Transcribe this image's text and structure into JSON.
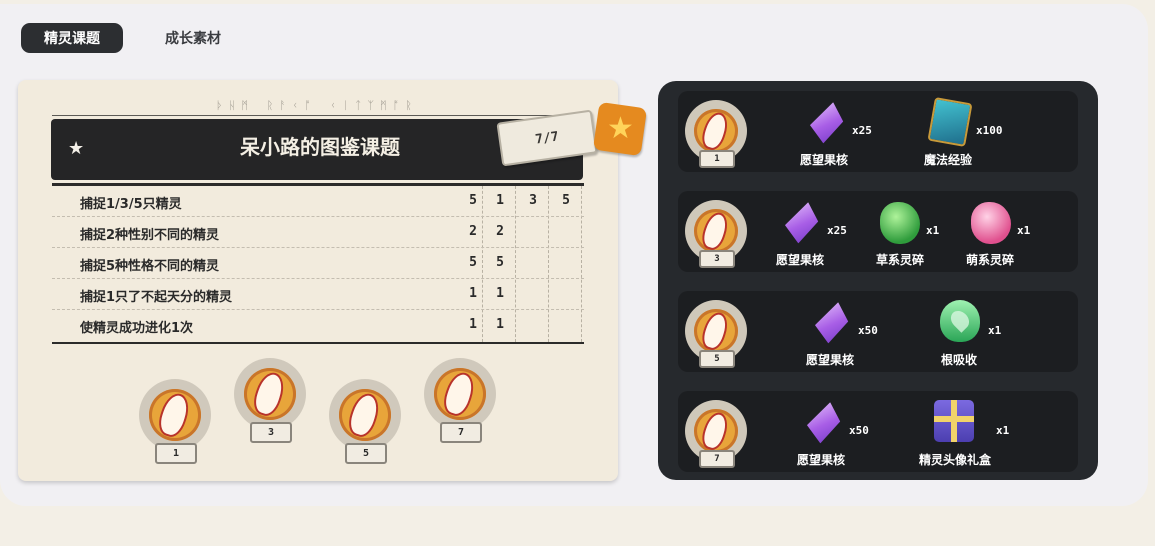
{
  "tabs": [
    {
      "label": "精灵课题",
      "active": true
    },
    {
      "label": "成长素材",
      "active": false
    }
  ],
  "left_card": {
    "rune_text": "ᚦᚺᛗ ᚱᚨᚲᚩ ᚲᛁᛏᛉᛗᚩᚱ",
    "title": "呆小路的图鉴课题",
    "progress": "7/7",
    "tasks": [
      {
        "label": "捕捉1/3/5只精灵",
        "values": [
          "5",
          "1",
          "3",
          "5"
        ]
      },
      {
        "label": "捕捉2种性别不同的精灵",
        "values": [
          "2",
          "2",
          "",
          ""
        ]
      },
      {
        "label": "捕捉5种性格不同的精灵",
        "values": [
          "5",
          "5",
          "",
          ""
        ]
      },
      {
        "label": "捕捉1只了不起天分的精灵",
        "values": [
          "1",
          "1",
          "",
          ""
        ]
      },
      {
        "label": "使精灵成功进化1次",
        "values": [
          "1",
          "1",
          "",
          ""
        ]
      }
    ],
    "medals": [
      "1",
      "3",
      "5",
      "7"
    ]
  },
  "rewards": [
    {
      "tier": "1",
      "items": [
        {
          "name": "愿望果核",
          "qty": "x25",
          "icon": "crystal"
        },
        {
          "name": "魔法经验",
          "qty": "x100",
          "icon": "book"
        }
      ]
    },
    {
      "tier": "3",
      "items": [
        {
          "name": "愿望果核",
          "qty": "x25",
          "icon": "crystal"
        },
        {
          "name": "草系灵碎",
          "qty": "x1",
          "icon": "leafgem"
        },
        {
          "name": "萌系灵碎",
          "qty": "x1",
          "icon": "pinkgem"
        }
      ]
    },
    {
      "tier": "5",
      "items": [
        {
          "name": "愿望果核",
          "qty": "x50",
          "icon": "crystal"
        },
        {
          "name": "根吸收",
          "qty": "x1",
          "icon": "greenleaf"
        }
      ]
    },
    {
      "tier": "7",
      "items": [
        {
          "name": "愿望果核",
          "qty": "x50",
          "icon": "crystal"
        },
        {
          "name": "精灵头像礼盒",
          "qty": "x1",
          "icon": "giftbox"
        }
      ]
    }
  ]
}
